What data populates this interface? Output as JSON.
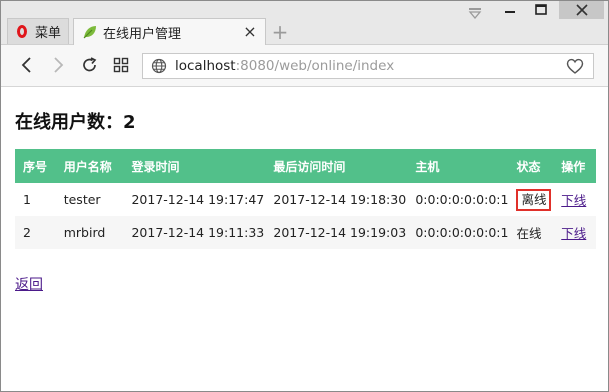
{
  "browser": {
    "menu_label": "菜单",
    "tab_title": "在线用户管理",
    "url_host": "localhost",
    "url_rest": ":8080/web/online/index"
  },
  "page": {
    "heading": "在线用户数：2",
    "columns": [
      "序号",
      "用户名称",
      "登录时间",
      "最后访问时间",
      "主机",
      "状态",
      "操作"
    ],
    "rows": [
      {
        "index": "1",
        "username": "tester",
        "login_time": "2017-12-14 19:17:47",
        "last_access": "2017-12-14 19:18:30",
        "host": "0:0:0:0:0:0:0:1",
        "status": "离线",
        "action": "下线"
      },
      {
        "index": "2",
        "username": "mrbird",
        "login_time": "2017-12-14 19:11:33",
        "last_access": "2017-12-14 19:19:03",
        "host": "0:0:0:0:0:0:0:1",
        "status": "在线",
        "action": "下线"
      }
    ],
    "back_link": "返回"
  },
  "colors": {
    "header_green": "#52c08a",
    "highlight_red": "#e0302a",
    "link_purple": "#4b1a8a"
  }
}
